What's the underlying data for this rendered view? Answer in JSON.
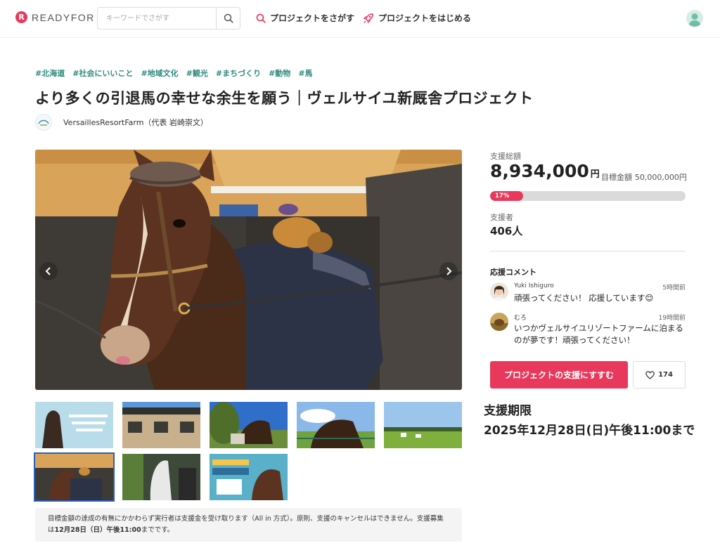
{
  "header": {
    "logo_mark": "R",
    "logo_text": "READYFOR",
    "search_placeholder": "キーワードでさがす",
    "nav_find": "プロジェクトをさがす",
    "nav_start": "プロジェクトをはじめる"
  },
  "project": {
    "tags": [
      "#北海道",
      "#社会にいいこと",
      "#地域文化",
      "#観光",
      "#まちづくり",
      "#動物",
      "#馬"
    ],
    "title": "より多くの引退馬の幸せな余生を願う｜ヴェルサイユ新厩舎プロジェクト",
    "owner": "VersaillesResortFarm（代表 岩崎崇文）"
  },
  "gallery": {
    "prev_icon": "chevron-left-icon",
    "next_icon": "chevron-right-icon",
    "selected_index": 5,
    "thumbnail_count": 8
  },
  "notice": {
    "text_1": "目標金額の達成の有無にかかわらず実行者は支援金を受け取ります（All in 方式）。原則、支援のキャンセルはできません。支援募集は",
    "deadline_bold": "12月28日（日）午後11:00",
    "text_2": "までです。"
  },
  "stats": {
    "total_label": "支援総額",
    "total_amount": "8,934,000",
    "total_unit": "円",
    "goal_label": "目標金額",
    "goal_amount": "50,000,000円",
    "progress_label": "17%",
    "progress_fraction": 0.17,
    "supporters_label": "支援者",
    "supporters_value": "406人"
  },
  "comments": {
    "title": "応援コメント",
    "items": [
      {
        "name": "Yuki Ishiguro",
        "time": "5時間前",
        "text": "頑張ってください！ 応援しています😌"
      },
      {
        "name": "むろ",
        "time": "19時間前",
        "text": "いつかヴェルサイユリゾートファームに泊まるのが夢です！頑張ってください！"
      }
    ]
  },
  "actions": {
    "support_button": "プロジェクトの支援にすすむ",
    "like_count": "174"
  },
  "deadline": {
    "label": "支援期限",
    "value": "2025年12月28日(日)午後11:00まで"
  },
  "colors": {
    "brand": "#e8395c",
    "tag": "#2f8b80",
    "progress_track": "#dadada"
  }
}
